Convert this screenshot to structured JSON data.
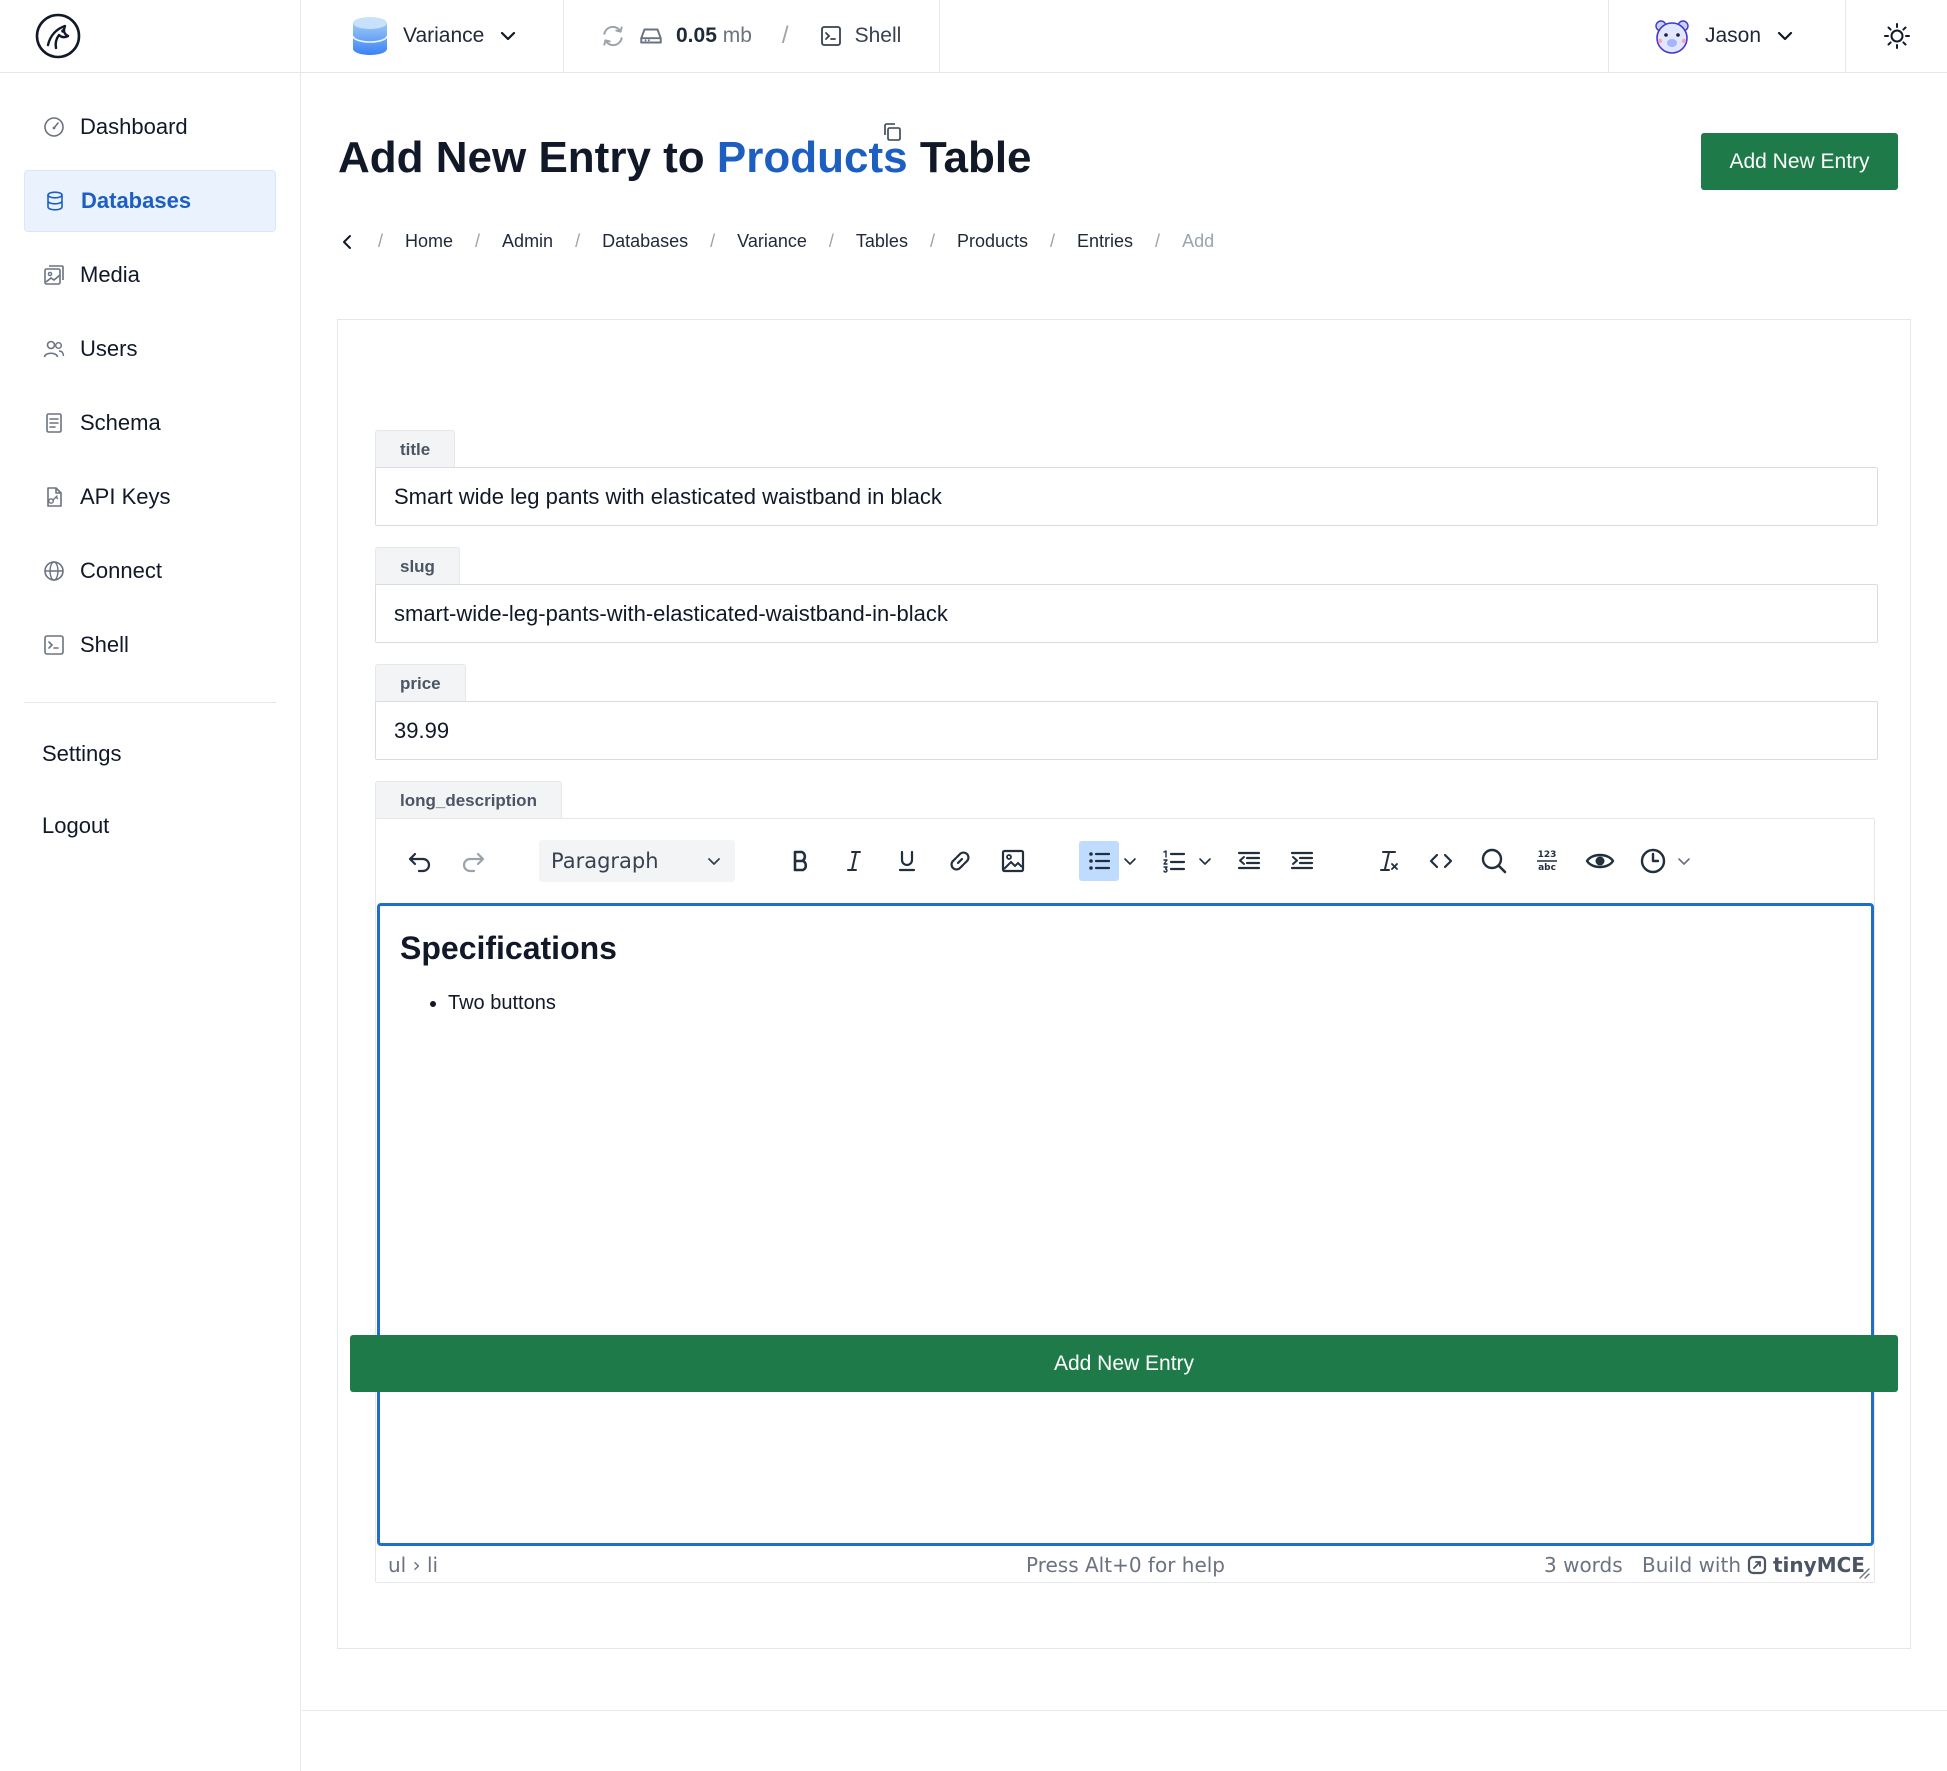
{
  "topbar": {
    "database_name": "Variance",
    "storage_value": "0.05",
    "storage_unit": "mb",
    "separator": "/",
    "shell_label": "Shell",
    "user_name": "Jason"
  },
  "sidebar": {
    "items": [
      {
        "label": "Dashboard",
        "icon": "gauge-icon"
      },
      {
        "label": "Databases",
        "icon": "database-icon",
        "active": true
      },
      {
        "label": "Media",
        "icon": "media-icon"
      },
      {
        "label": "Users",
        "icon": "users-icon"
      },
      {
        "label": "Schema",
        "icon": "document-icon"
      },
      {
        "label": "API Keys",
        "icon": "file-key-icon"
      },
      {
        "label": "Connect",
        "icon": "globe-icon"
      },
      {
        "label": "Shell",
        "icon": "terminal-icon"
      }
    ],
    "bottom_links": [
      {
        "label": "Settings"
      },
      {
        "label": "Logout"
      }
    ]
  },
  "page": {
    "title_prefix": "Add New Entry to",
    "title_highlight": "Products",
    "title_suffix": "Table",
    "add_button": "Add New Entry"
  },
  "breadcrumb": {
    "items": [
      "Home",
      "Admin",
      "Databases",
      "Variance",
      "Tables",
      "Products",
      "Entries"
    ],
    "current": "Add",
    "separator": "/"
  },
  "form": {
    "fields": [
      {
        "label": "title",
        "value": "Smart wide leg pants with elasticated waistband in black"
      },
      {
        "label": "slug",
        "value": "smart-wide-leg-pants-with-elasticated-waistband-in-black"
      },
      {
        "label": "price",
        "value": "39.99"
      }
    ],
    "editor_label": "long_description",
    "submit_button": "Add New Entry"
  },
  "editor": {
    "block_format": "Paragraph",
    "toolbar_icons": [
      "undo-icon",
      "redo-icon",
      "bold-icon",
      "italic-icon",
      "underline-icon",
      "link-icon",
      "image-icon",
      "bullet-list-icon",
      "numbered-list-icon",
      "outdent-icon",
      "indent-icon",
      "clear-format-icon",
      "code-icon",
      "search-icon",
      "spellcheck-icon",
      "preview-icon",
      "history-icon"
    ],
    "content": {
      "heading": "Specifications",
      "list_items": [
        "Two buttons"
      ]
    },
    "status": {
      "path": "ul › li",
      "help": "Press Alt+0 for help",
      "word_count": "3 words",
      "brand_prefix": "Build with",
      "brand_name": "tinyMCE"
    }
  },
  "colors": {
    "accent_blue": "#1d5fc1",
    "primary_green": "#1e7b49",
    "active_bg": "#eaf2fd",
    "editor_focus": "#1d6fc9"
  }
}
